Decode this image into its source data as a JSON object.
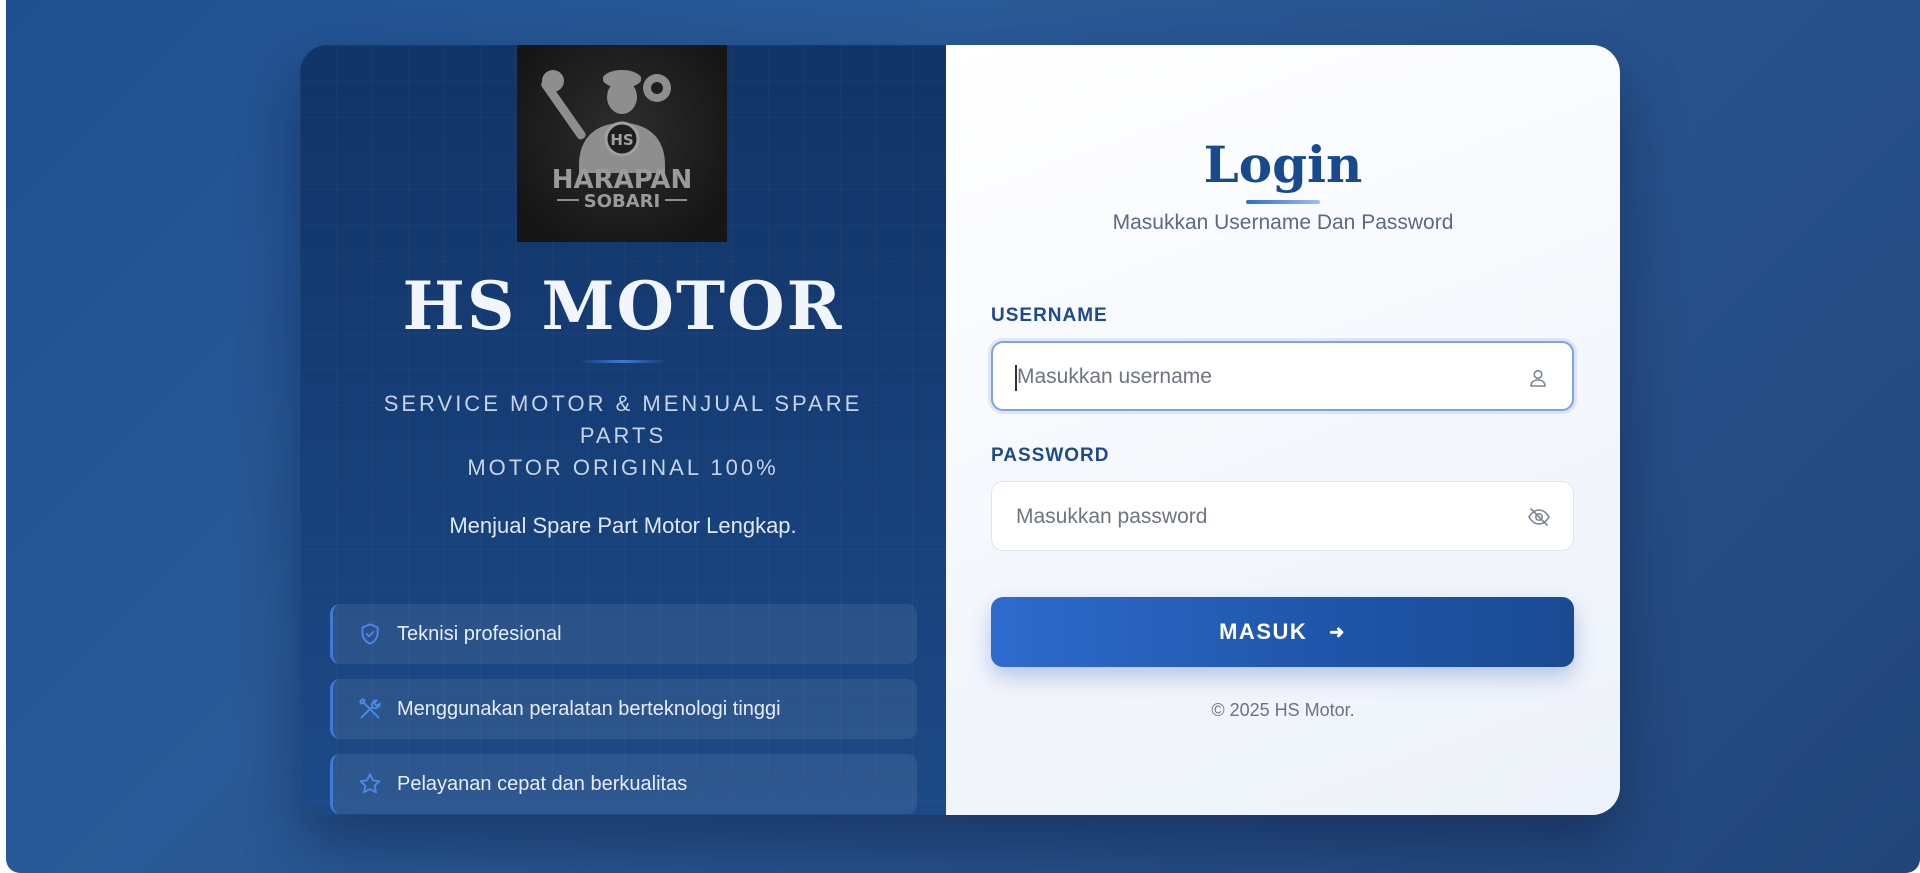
{
  "brand": {
    "logo_text": "HARAPAN SOBARI",
    "logo_badge": "HS",
    "name": "HS MOTOR",
    "tagline_line1": "SERVICE MOTOR & MENJUAL SPARE PARTS",
    "tagline_line2": "MOTOR ORIGINAL 100%",
    "description": "Menjual Spare Part Motor Lengkap."
  },
  "features": [
    {
      "icon": "shield-check-icon",
      "label": "Teknisi profesional"
    },
    {
      "icon": "tools-icon",
      "label": "Menggunakan peralatan berteknologi tinggi"
    },
    {
      "icon": "star-icon",
      "label": "Pelayanan cepat dan berkualitas"
    }
  ],
  "login": {
    "title": "Login",
    "subtitle": "Masukkan Username Dan Password",
    "username_label": "USERNAME",
    "username_placeholder": "Masukkan username",
    "password_label": "PASSWORD",
    "password_placeholder": "Masukkan password",
    "submit_label": "MASUK",
    "copyright": "© 2025 HS Motor."
  },
  "colors": {
    "primary": "#1a4a8e",
    "accent": "#2e6bcd",
    "panel_dark": "#123467"
  }
}
